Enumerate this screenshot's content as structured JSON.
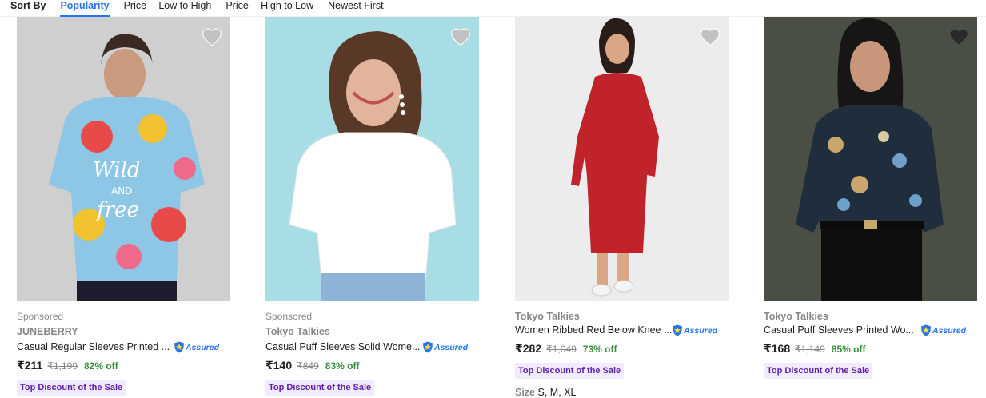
{
  "sort": {
    "label": "Sort By",
    "options": [
      "Popularity",
      "Price -- Low to High",
      "Price -- High to Low",
      "Newest First"
    ],
    "active": "Popularity"
  },
  "assured_label": "Assured",
  "products": [
    {
      "sponsored": "Sponsored",
      "brand": "JUNEBERRY",
      "title": "Casual Regular Sleeves Printed ...",
      "price": "₹211",
      "mrp": "₹1,199",
      "discount": "82% off",
      "deal": "Top Discount of the Sale"
    },
    {
      "sponsored": "Sponsored",
      "brand": "Tokyo Talkies",
      "title": "Casual Puff Sleeves Solid Wome...",
      "price": "₹140",
      "mrp": "₹849",
      "discount": "83% off",
      "deal": "Top Discount of the Sale"
    },
    {
      "brand": "Tokyo Talkies",
      "title": "Women Ribbed Red Below Knee ...",
      "price": "₹282",
      "mrp": "₹1,049",
      "discount": "73% off",
      "deal": "Top Discount of the Sale",
      "size_label": "Size",
      "sizes": "S, M, XL"
    },
    {
      "brand": "Tokyo Talkies",
      "title": "Casual Puff Sleeves Printed Wo...",
      "price": "₹168",
      "mrp": "₹1,149",
      "discount": "85% off",
      "deal": "Top Discount of the Sale"
    }
  ]
}
